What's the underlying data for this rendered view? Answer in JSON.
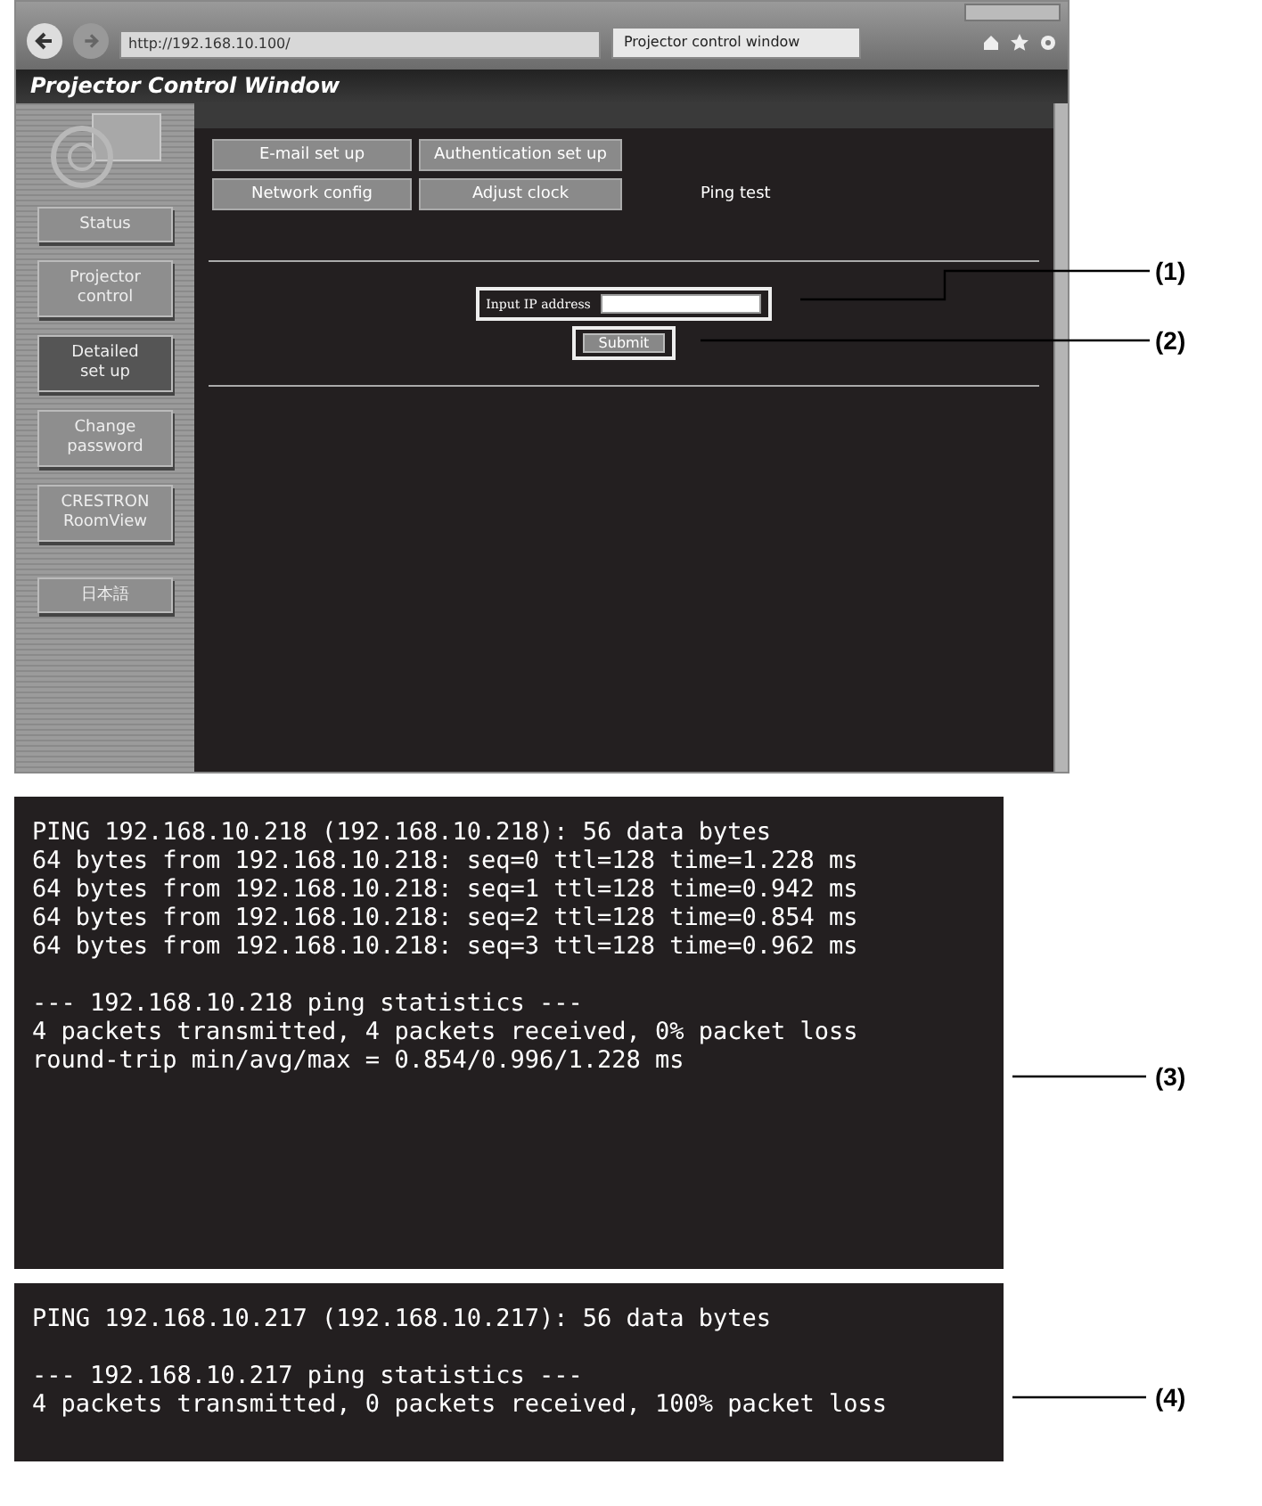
{
  "browser": {
    "address": "http://192.168.10.100/",
    "tab": "Projector control window"
  },
  "app_title": "Projector Control Window",
  "sidebar": [
    {
      "label": "Status",
      "selected": false
    },
    {
      "label": "Projector\ncontrol",
      "selected": false
    },
    {
      "label": "Detailed\nset up",
      "selected": true
    },
    {
      "label": "Change\npassword",
      "selected": false
    },
    {
      "label": "CRESTRON\nRoomView",
      "selected": false
    },
    {
      "label": "日本語",
      "selected": false
    }
  ],
  "menu": [
    {
      "label": "E-mail set up",
      "selected": false
    },
    {
      "label": "Authentication set up",
      "selected": false
    },
    {
      "label": "Network config",
      "selected": false
    },
    {
      "label": "Adjust clock",
      "selected": false
    },
    {
      "label": "Ping test",
      "selected": true
    }
  ],
  "ip_field": {
    "label": "Input IP address"
  },
  "submit": "Submit",
  "callouts": [
    "(1)",
    "(2)",
    "(3)",
    "(4)"
  ],
  "outputs": [
    {
      "blocks": [
        [
          "PING 192.168.10.218 (192.168.10.218): 56 data bytes",
          "64 bytes from 192.168.10.218: seq=0 ttl=128 time=1.228 ms",
          "64 bytes from 192.168.10.218: seq=1 ttl=128 time=0.942 ms",
          "64 bytes from 192.168.10.218: seq=2 ttl=128 time=0.854 ms",
          "64 bytes from 192.168.10.218: seq=3 ttl=128 time=0.962 ms"
        ],
        [
          "--- 192.168.10.218 ping statistics ---",
          "4 packets transmitted, 4 packets received, 0% packet loss",
          "round-trip min/avg/max = 0.854/0.996/1.228 ms"
        ]
      ]
    },
    {
      "blocks": [
        [
          "PING 192.168.10.217 (192.168.10.217): 56 data bytes"
        ],
        [
          "--- 192.168.10.217 ping statistics ---",
          "4 packets transmitted, 0 packets received, 100% packet loss"
        ]
      ]
    }
  ]
}
